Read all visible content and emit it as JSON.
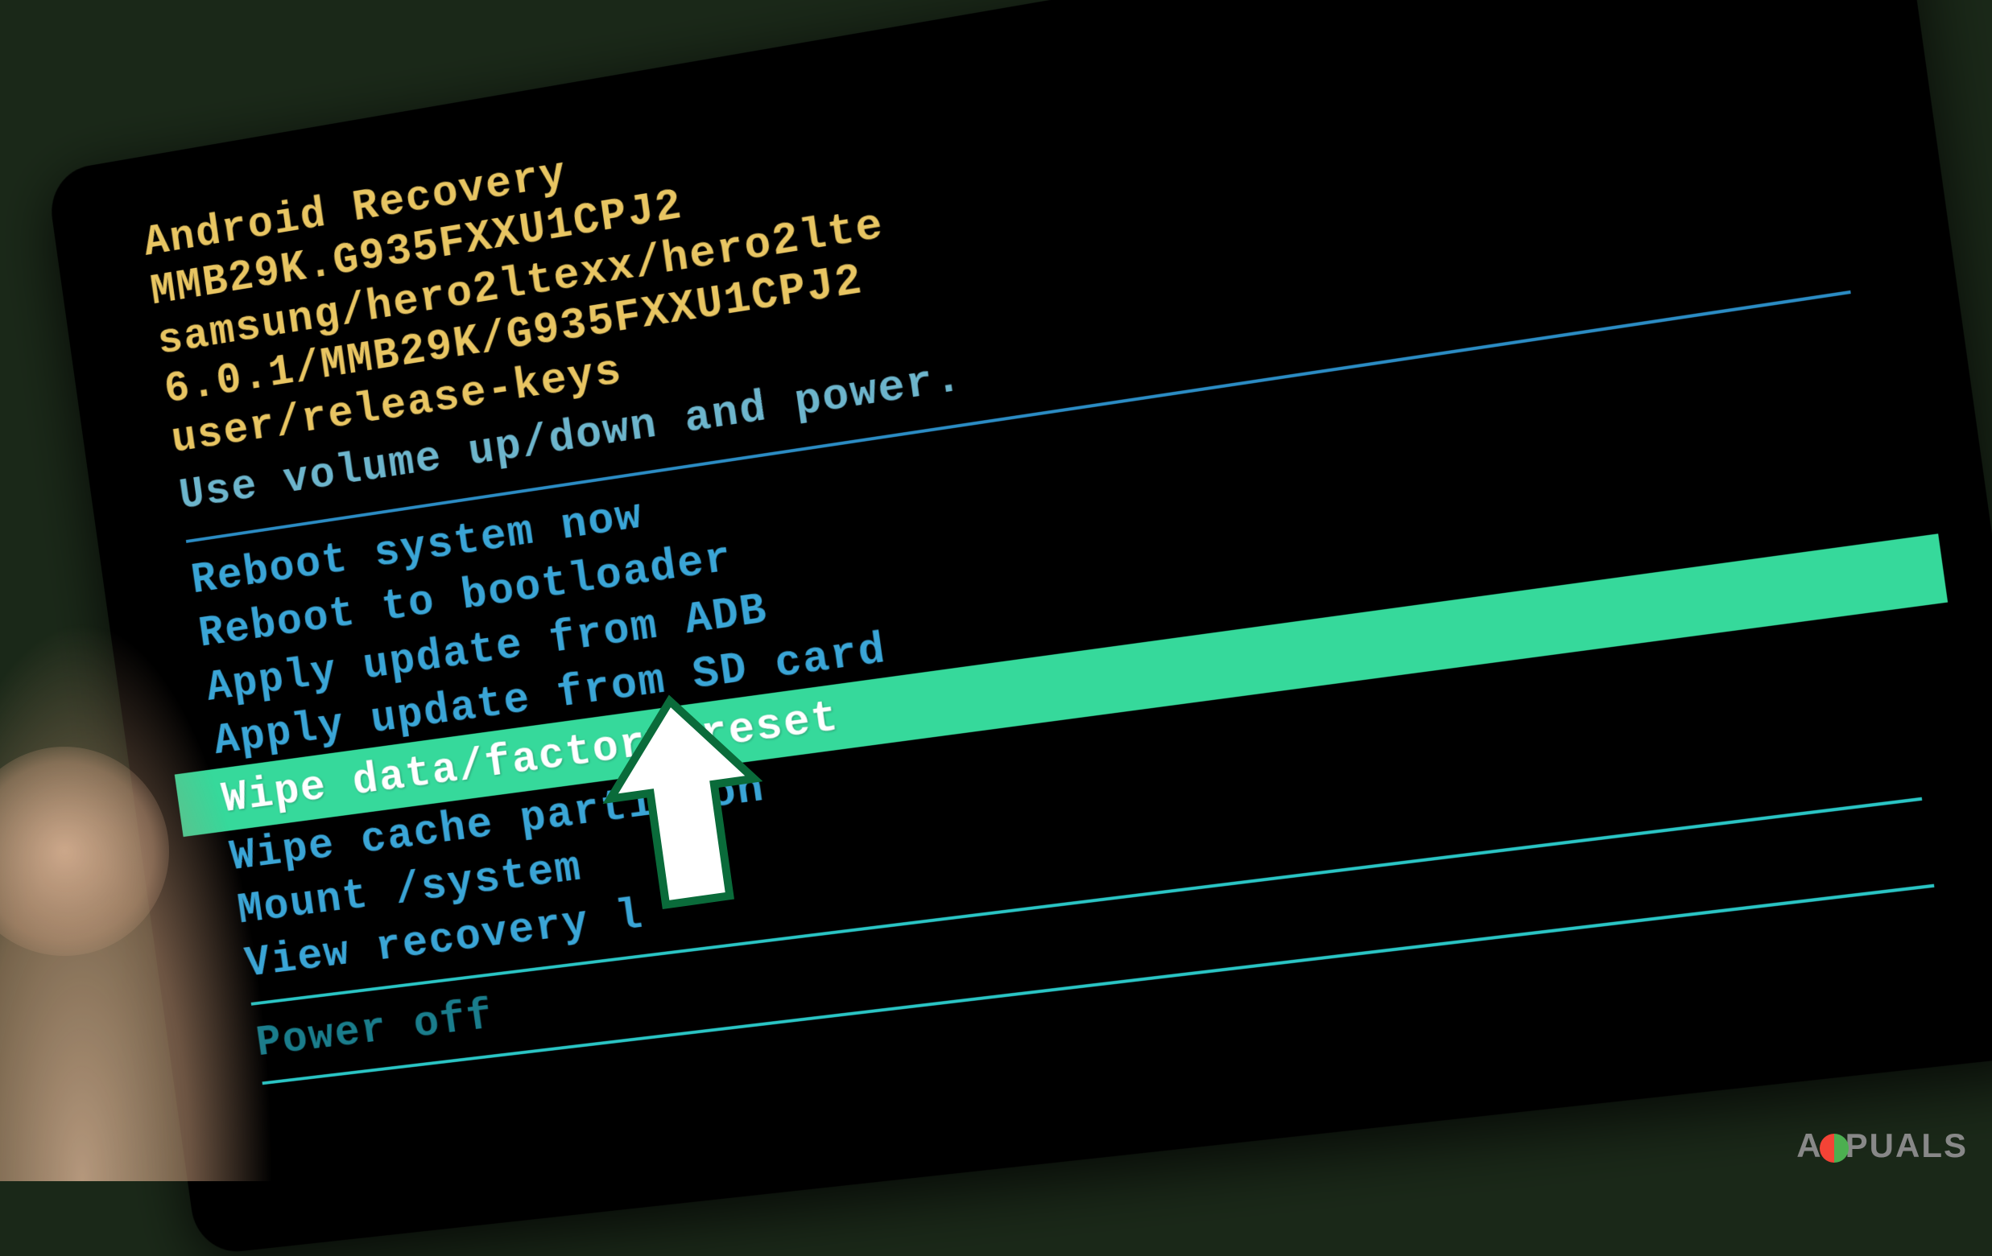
{
  "header": {
    "title": "Android Recovery",
    "build": "MMB29K.G935FXXU1CPJ2",
    "device": "samsung/hero2ltexx/hero2lte",
    "version": "6.0.1/MMB29K/G935FXXU1CPJ2",
    "keys": "user/release-keys",
    "instruction": "Use volume up/down and power."
  },
  "menu": {
    "items": [
      {
        "label": "Reboot system now",
        "selected": false
      },
      {
        "label": "Reboot to bootloader",
        "selected": false
      },
      {
        "label": "Apply update from ADB",
        "selected": false
      },
      {
        "label": "Apply update from SD card",
        "selected": false
      },
      {
        "label": "Wipe data/factory reset",
        "selected": true
      },
      {
        "label": "Wipe cache partition",
        "selected": false
      },
      {
        "label": "Mount /system",
        "selected": false
      },
      {
        "label": "View recovery l",
        "selected": false
      },
      {
        "label": "Power off",
        "selected": false
      }
    ]
  },
  "watermark": {
    "text_before": "A",
    "text_after": "PUALS"
  }
}
